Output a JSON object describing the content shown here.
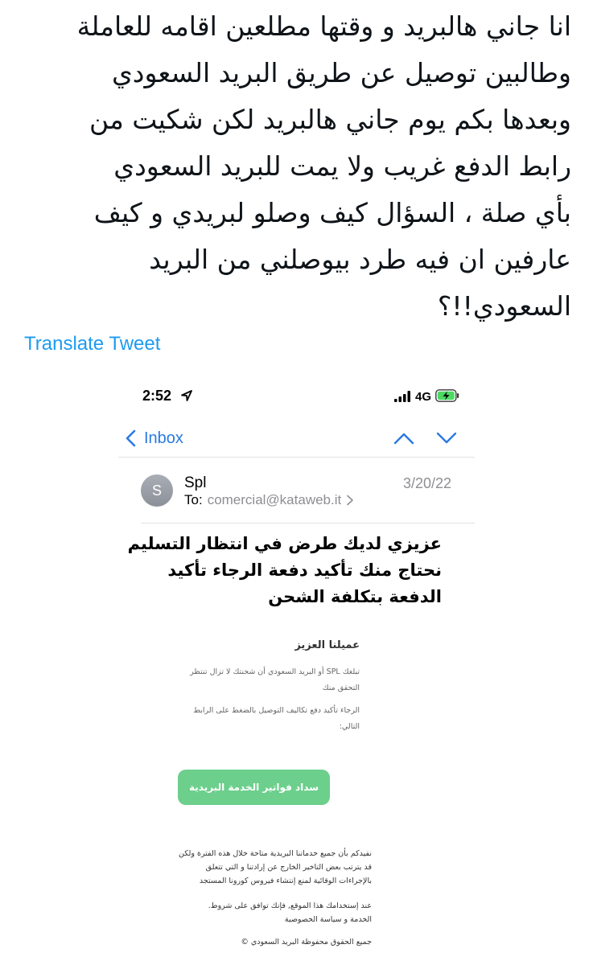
{
  "tweet": {
    "lines": [
      "انا جاني هالبريد و وقتها مطلعين اقامه للعاملة",
      "وطالبين توصيل عن طريق البريد السعودي",
      "وبعدها بكم يوم جاني هالبريد لكن شكيت من",
      "رابط الدفع غريب ولا يمت للبريد السعودي",
      "بأي صلة ، السؤال كيف وصلو لبريدي و كيف",
      "عارفين ان فيه طرد بيوصلني من البريد",
      "السعودي!!؟"
    ],
    "translate_label": "Translate Tweet"
  },
  "status_bar": {
    "time": "2:52",
    "network": "4G",
    "icons": [
      "location-arrow-icon",
      "signal-bars-icon",
      "battery-charging-icon"
    ]
  },
  "mail": {
    "nav": {
      "back_label": "Inbox",
      "icons": [
        "chevron-left-icon",
        "chevron-up-icon",
        "chevron-down-icon"
      ]
    },
    "avatar_initial": "S",
    "sender": "Spl",
    "date": "3/20/22",
    "to_label": "To:",
    "to_address": "comercial@kataweb.it",
    "subject_lines": [
      "عزيزي لديك طرض في انتظار التسليم",
      "نحتاج منك تأكيد دفعة الرجاء تأكيد",
      "الدفعة بتكلفة الشحن"
    ],
    "body": {
      "greeting": "عميلنا العزيز",
      "paragraph1_lines": [
        "تبلغك SPL أو البريد السعودي أن شحنتك لا تزال تنتظر",
        "التحقق منك"
      ],
      "paragraph2_lines": [
        "الرجاء تأكيد دفع تكاليف التوصيل بالضغط على الرابط",
        "التالي:"
      ],
      "cta_label": "سداد فواتير الخدمة البريدية",
      "cta_color": "#6ccf8c"
    },
    "footer": {
      "paragraph1_lines": [
        "نفيدكم بأن جميع خدماتنا البريدية متاحة خلال هذه الفترة ولكن",
        "قد يترتب بعض التاخير الخارج عن إرادتنا و التي تتعلق",
        "بالإجراءات الوقائية لمنع إنتشاء فيروس كورونا المستجد"
      ],
      "paragraph2_lines": [
        "عند إستخدامك هذا الموقع, فإنك توافق على شروط.",
        "الخدمة و سياسة الخصوصية"
      ],
      "copyright": "جميع الحقوق محفوظة البريد السعودي ©"
    }
  },
  "colors": {
    "link_blue": "#1d9bf0",
    "ios_blue": "#2a7ae2",
    "gray": "#8e8e93"
  }
}
